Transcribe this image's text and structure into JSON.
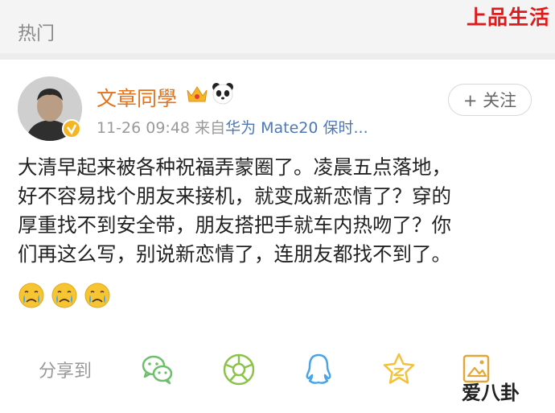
{
  "header": {
    "title": "热门"
  },
  "watermark_top": "上品生活",
  "post": {
    "username": "文章同學",
    "timestamp": "11-26 09:48",
    "source_prefix": "来自",
    "source_device": "华为 Mate20 保时...",
    "follow_label": "+ 关注",
    "text_lines": [
      "大清早起来被各种祝福弄蒙圈了。凌晨五点落地，",
      "好不容易找个朋友来接机，就变成新恋情了？穿的",
      "厚重找不到安全带，朋友搭把手就车内热吻了？你",
      "们再这么写，别说新恋情了，连朋友都找不到了。"
    ],
    "emojis": [
      "crying-face",
      "crying-face",
      "crying-face"
    ]
  },
  "share": {
    "label": "分享到",
    "targets": [
      "wechat",
      "moments",
      "qq",
      "qzone",
      "save-image"
    ]
  },
  "watermark_bottom": "爱八卦",
  "colors": {
    "username": "#e0731c",
    "device": "#4a78b8",
    "watermark": "#e01a1a",
    "share_green": "#6cc06c",
    "share_blue": "#4ba4e6",
    "share_yellow": "#f3c13a"
  }
}
